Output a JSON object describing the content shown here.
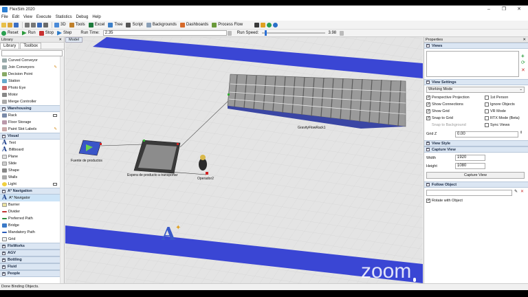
{
  "window": {
    "title": "FlexSim 2020"
  },
  "menu": [
    "File",
    "Edit",
    "View",
    "Execute",
    "Statistics",
    "Debug",
    "Help"
  ],
  "toolbar": {
    "buttons": [
      "3D",
      "Tools",
      "Excel",
      "Tree",
      "Script",
      "Backgrounds",
      "Dashboards",
      "Process Flow"
    ]
  },
  "runbar": {
    "reset": "Reset",
    "run": "Run",
    "stop": "Stop",
    "step": "Step",
    "run_time_label": "Run Time:",
    "run_time": "2.35",
    "run_speed_label": "Run Speed:",
    "run_speed": "3.98"
  },
  "library": {
    "header": "Library",
    "tabs": [
      "Library",
      "Toolbox"
    ],
    "items_top": [
      "Curved Conveyor",
      "Join Conveyors",
      "Decision Point",
      "Station",
      "Photo Eye",
      "Motor",
      "Merge Controller"
    ],
    "warehousing": {
      "label": "Warehousing",
      "items": [
        "Rack",
        "Floor Storage",
        "Paint Slot Labels"
      ]
    },
    "visual": {
      "label": "Visual",
      "items": [
        "Text",
        "Billboard",
        "Plane",
        "Slide",
        "Shape",
        "Walls",
        "Light"
      ]
    },
    "navigation": {
      "label": "A* Navigation",
      "items": [
        "A* Navigator",
        "Barrier",
        "Divider",
        "Preferred Path",
        "Bridge",
        "Mandatory Path",
        "Grid"
      ]
    },
    "collapsed": [
      "FloWorks",
      "AGV",
      "Bottling",
      "Fluid",
      "People"
    ],
    "selected": "A* Navigator"
  },
  "viewport": {
    "tab": "Model",
    "labels": {
      "source": "Fuente de productos",
      "queue": "Espera de producto a transportar",
      "operator": "Operador2",
      "rack": "GravityFlowRack1"
    }
  },
  "properties": {
    "header": "Properties",
    "views_label": "Views",
    "view_settings_label": "View Settings",
    "working_mode": "Working Mode",
    "checks_left": [
      {
        "label": "Perspective Projection",
        "on": true
      },
      {
        "label": "Show Connections",
        "on": true
      },
      {
        "label": "Show Grid",
        "on": true
      },
      {
        "label": "Snap to Grid",
        "on": true
      },
      {
        "label": "Snap to Background",
        "on": false,
        "disabled": true
      }
    ],
    "checks_right": [
      {
        "label": "1st Person",
        "on": false
      },
      {
        "label": "Ignore Objects",
        "on": false
      },
      {
        "label": "VR Mode",
        "on": false
      },
      {
        "label": "RTX Mode (Beta)",
        "on": false
      },
      {
        "label": "Sync Views",
        "on": false
      }
    ],
    "grid_z_label": "Grid Z",
    "grid_z": "0.00",
    "view_style_label": "View Style",
    "capture_view_label": "Capture View",
    "width_label": "Width",
    "width": "1920",
    "height_label": "Height",
    "height": "1080",
    "capture_button": "Capture View",
    "follow_object_label": "Follow Object",
    "rotate_with_object": "Rotate with Object"
  },
  "status": "Done Binding Objects.",
  "overlay": {
    "zoom": "zoom"
  },
  "colors": {
    "lane": "#3a46d4",
    "floor": "#e4e4e4",
    "accent": "#2a7fd4"
  }
}
